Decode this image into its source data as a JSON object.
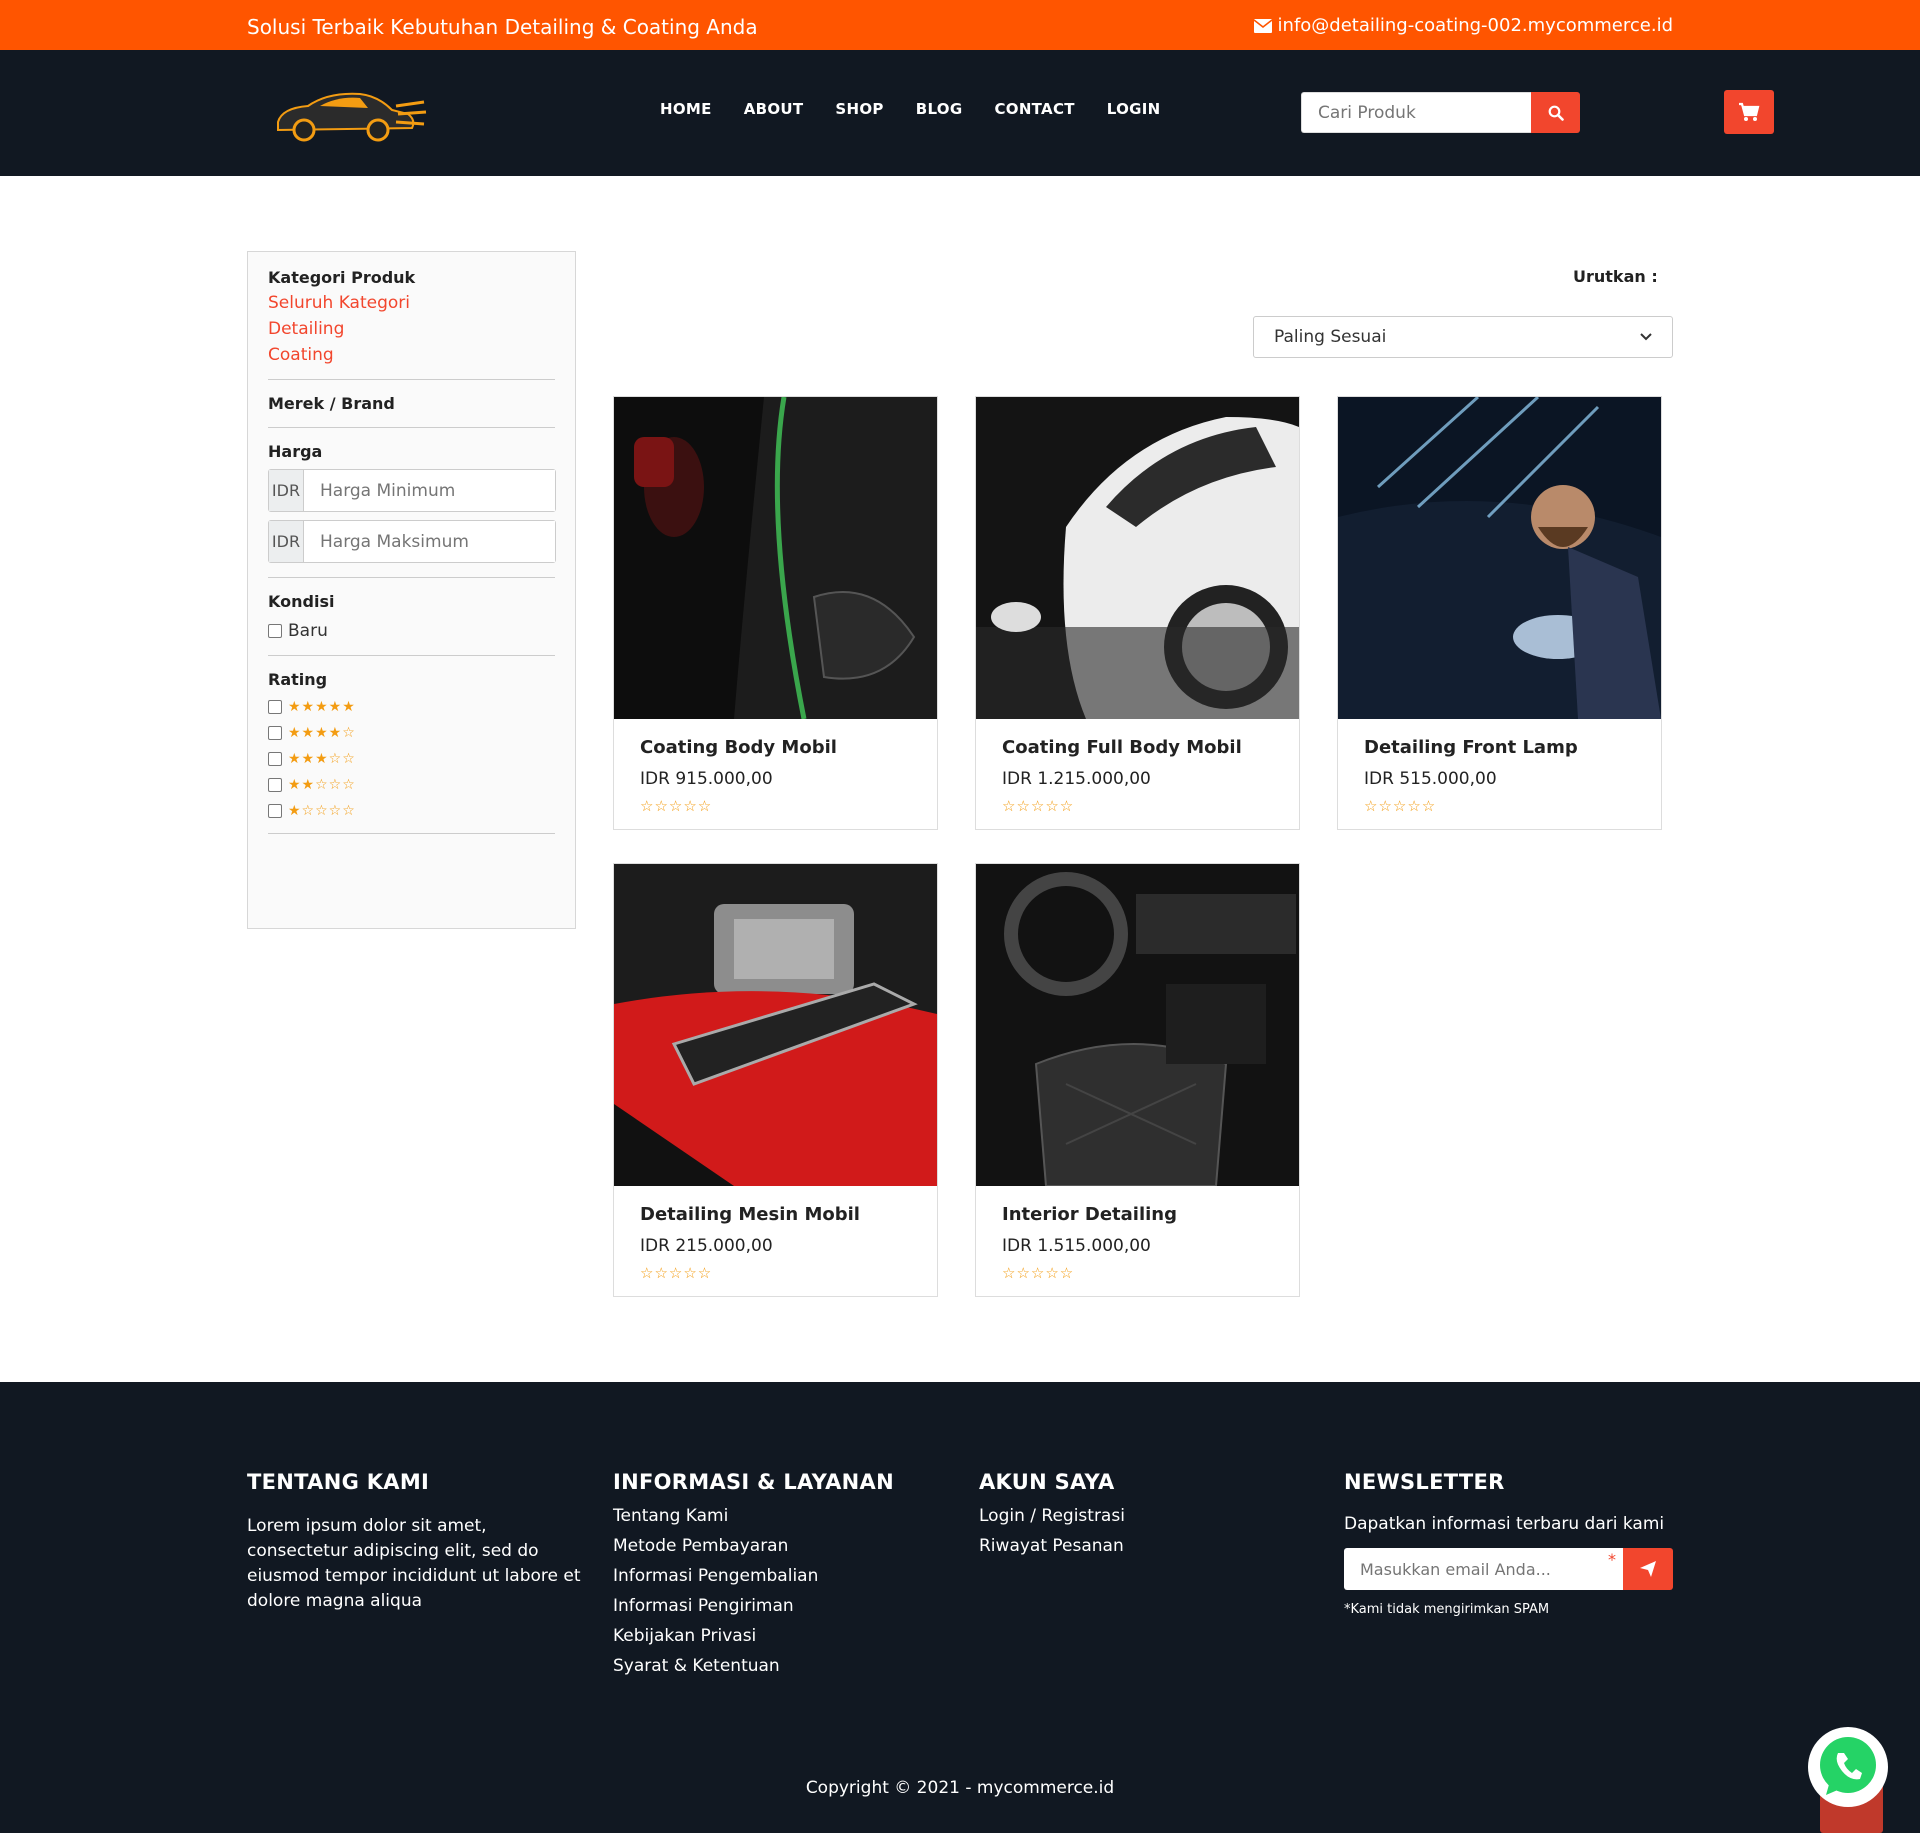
{
  "topbar": {
    "tagline": "Solusi Terbaik Kebutuhan Detailing & Coating Anda",
    "email": "info@detailing-coating-002.mycommerce.id"
  },
  "nav": {
    "items": [
      "HOME",
      "ABOUT",
      "SHOP",
      "BLOG",
      "CONTACT",
      "LOGIN"
    ],
    "search_placeholder": "Cari Produk"
  },
  "sidebar": {
    "category_title": "Kategori Produk",
    "categories": [
      "Seluruh Kategori",
      "Detailing",
      "Coating"
    ],
    "brand_title": "Merek / Brand",
    "price_title": "Harga",
    "currency": "IDR",
    "min_placeholder": "Harga Minimum",
    "max_placeholder": "Harga Maksimum",
    "condition_title": "Kondisi",
    "condition_new": "Baru",
    "rating_title": "Rating",
    "ratings": [
      "★★★★★",
      "★★★★☆",
      "★★★☆☆",
      "★★☆☆☆",
      "★☆☆☆☆"
    ]
  },
  "sort": {
    "label": "Urutkan :",
    "selected": "Paling Sesuai"
  },
  "products": [
    {
      "name": "Coating Body Mobil",
      "price": "IDR 915.000,00",
      "stars": "☆☆☆☆☆"
    },
    {
      "name": "Coating Full Body Mobil",
      "price": "IDR 1.215.000,00",
      "stars": "☆☆☆☆☆"
    },
    {
      "name": "Detailing Front Lamp",
      "price": "IDR 515.000,00",
      "stars": "☆☆☆☆☆"
    },
    {
      "name": "Detailing Mesin Mobil",
      "price": "IDR 215.000,00",
      "stars": "☆☆☆☆☆"
    },
    {
      "name": "Interior Detailing",
      "price": "IDR 1.515.000,00",
      "stars": "☆☆☆☆☆"
    }
  ],
  "footer": {
    "about_title": "TENTANG KAMI",
    "about_text": "Lorem ipsum dolor sit amet, consectetur adipiscing elit, sed do eiusmod tempor incididunt ut labore et dolore magna aliqua",
    "info_title": "INFORMASI & LAYANAN",
    "info_links": [
      "Tentang Kami",
      "Metode Pembayaran",
      "Informasi Pengembalian",
      "Informasi Pengiriman",
      "Kebijakan Privasi",
      "Syarat & Ketentuan"
    ],
    "account_title": "AKUN SAYA",
    "account_links": [
      "Login / Registrasi",
      "Riwayat Pesanan"
    ],
    "newsletter_title": "NEWSLETTER",
    "newsletter_text": "Dapatkan informasi terbaru dari kami",
    "newsletter_placeholder": "Masukkan email Anda...",
    "required_mark": "*",
    "no_spam": "*Kami tidak mengirimkan SPAM",
    "copyright": "Copyright © 2021 - mycommerce.id"
  },
  "colors": {
    "accent": "#f2462d",
    "topbar": "#ff5500",
    "dark": "#111822",
    "star": "#f39c12"
  }
}
